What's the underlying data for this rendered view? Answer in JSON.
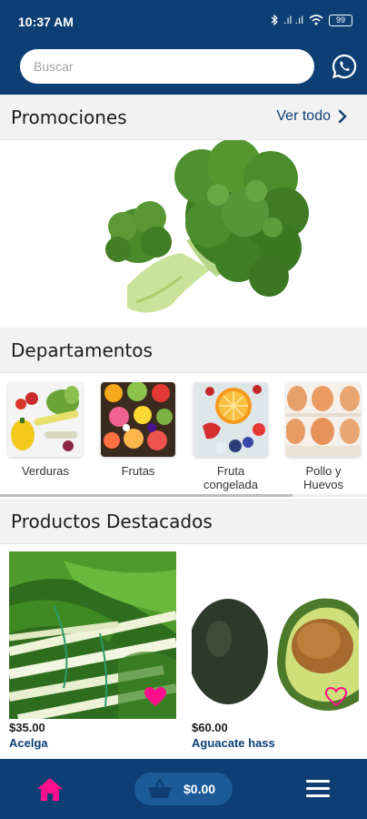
{
  "status_bar": {
    "time": "10:37 AM",
    "signal": ".ıl .ıl",
    "battery": "99"
  },
  "search": {
    "placeholder": "Buscar"
  },
  "icons": {
    "whatsapp": "whatsapp-icon",
    "chevron": "chevron-right-icon",
    "heart": "heart-icon",
    "home": "home-icon",
    "cart": "basket-icon",
    "menu": "hamburger-menu-icon"
  },
  "colors": {
    "primary": "#0d3f74",
    "accent": "#ff0f8b",
    "cart_pill": "#1d5b98"
  },
  "promotions": {
    "title": "Promociones",
    "see_all": "Ver todo"
  },
  "departments": {
    "title": "Departamentos",
    "items": [
      {
        "label": "Verduras"
      },
      {
        "label": "Frutas"
      },
      {
        "label": "Fruta congelada"
      },
      {
        "label": "Pollo y Huevos"
      }
    ]
  },
  "featured": {
    "title": "Productos Destacados",
    "products": [
      {
        "price": "$35.00",
        "name": "Acelga",
        "favorite": true
      },
      {
        "price": "$60.00",
        "name": "Aguacate hass",
        "favorite": false
      }
    ]
  },
  "bottom_nav": {
    "cart_total": "$0.00"
  }
}
